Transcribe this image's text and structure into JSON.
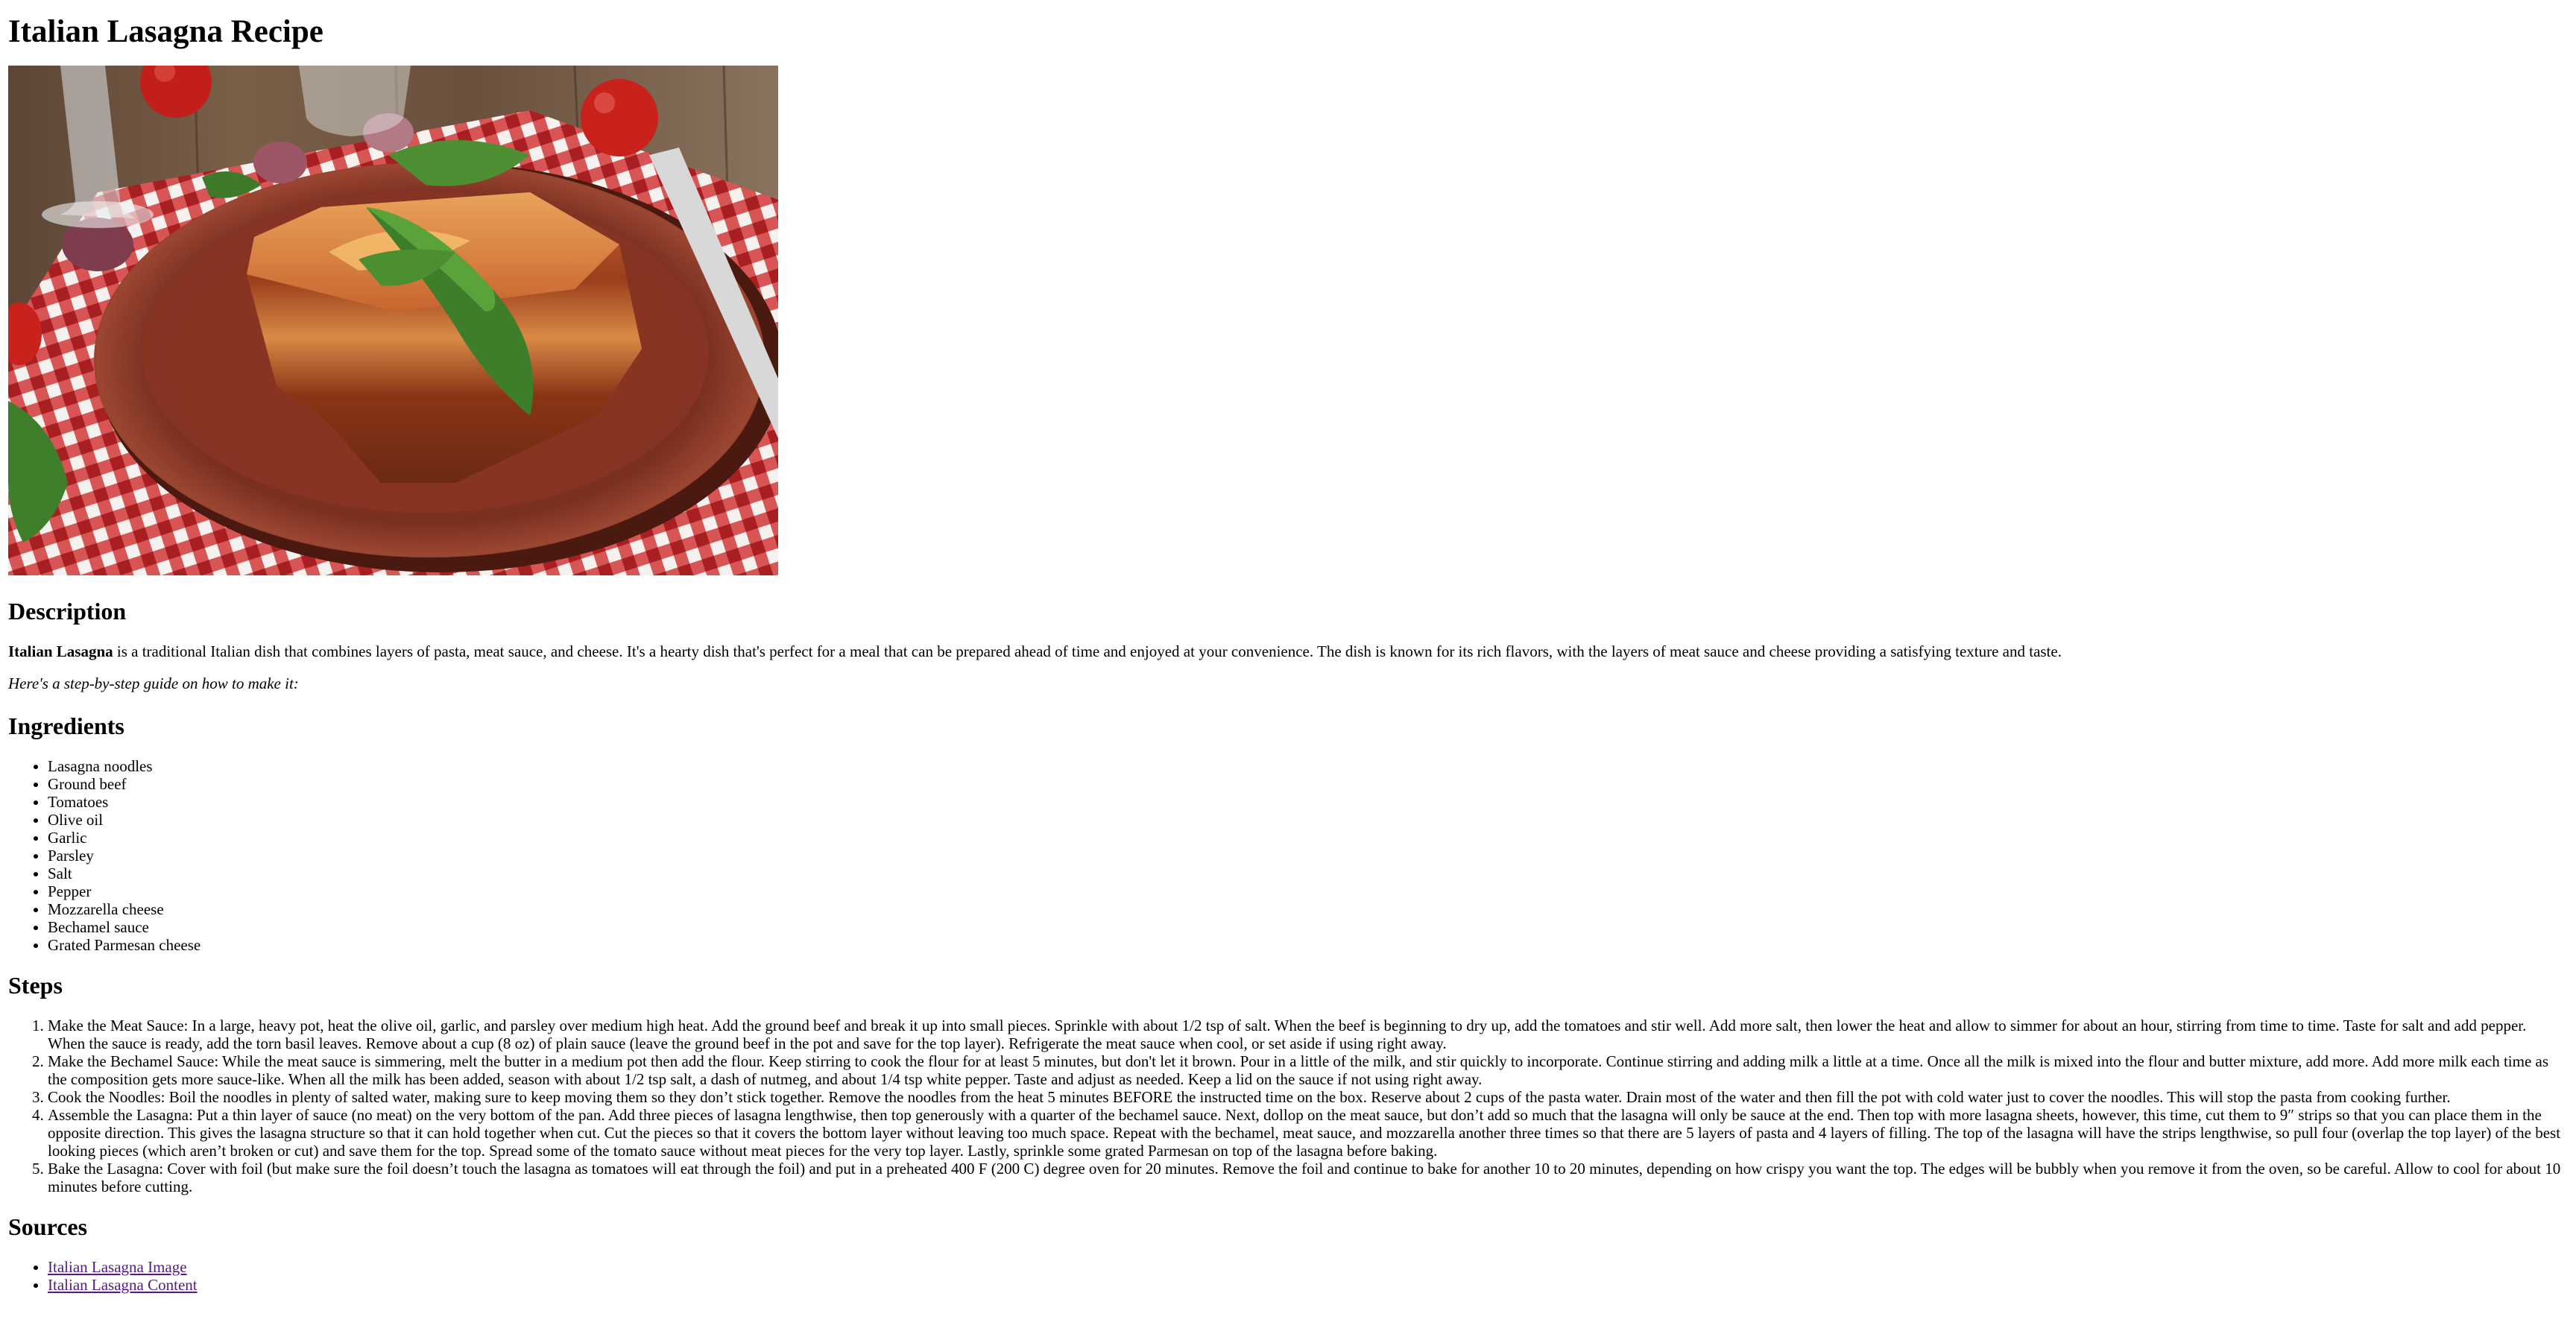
{
  "page": {
    "title": "Italian Lasagna Recipe"
  },
  "hero_image": {
    "alt": "Italian Lasagna"
  },
  "description": {
    "heading": "Description",
    "bold_lead": "Italian Lasagna",
    "text": " is a traditional Italian dish that combines layers of pasta, meat sauce, and cheese. It's a hearty dish that's perfect for a meal that can be prepared ahead of time and enjoyed at your convenience. The dish is known for its rich flavors, with the layers of meat sauce and cheese providing a satisfying texture and taste.",
    "intro": "Here's a step-by-step guide on how to make it:"
  },
  "ingredients": {
    "heading": "Ingredients",
    "items": [
      "Lasagna noodles",
      "Ground beef",
      "Tomatoes",
      "Olive oil",
      "Garlic",
      "Parsley",
      "Salt",
      "Pepper",
      "Mozzarella cheese",
      "Bechamel sauce",
      "Grated Parmesan cheese"
    ]
  },
  "steps": {
    "heading": "Steps",
    "items": [
      "Make the Meat Sauce: In a large, heavy pot, heat the olive oil, garlic, and parsley over medium high heat. Add the ground beef and break it up into small pieces. Sprinkle with about 1/2 tsp of salt. When the beef is beginning to dry up, add the tomatoes and stir well. Add more salt, then lower the heat and allow to simmer for about an hour, stirring from time to time. Taste for salt and add pepper. When the sauce is ready, add the torn basil leaves. Remove about a cup (8 oz) of plain sauce (leave the ground beef in the pot and save for the top layer). Refrigerate the meat sauce when cool, or set aside if using right away.",
      "Make the Bechamel Sauce: While the meat sauce is simmering, melt the butter in a medium pot then add the flour. Keep stirring to cook the flour for at least 5 minutes, but don't let it brown. Pour in a little of the milk, and stir quickly to incorporate. Continue stirring and adding milk a little at a time. Once all the milk is mixed into the flour and butter mixture, add more. Add more milk each time as the composition gets more sauce-like. When all the milk has been added, season with about 1/2 tsp salt, a dash of nutmeg, and about 1/4 tsp white pepper. Taste and adjust as needed. Keep a lid on the sauce if not using right away.",
      "Cook the Noodles: Boil the noodles in plenty of salted water, making sure to keep moving them so they don’t stick together. Remove the noodles from the heat 5 minutes BEFORE the instructed time on the box. Reserve about 2 cups of the pasta water. Drain most of the water and then fill the pot with cold water just to cover the noodles. This will stop the pasta from cooking further.",
      "Assemble the Lasagna: Put a thin layer of sauce (no meat) on the very bottom of the pan. Add three pieces of lasagna lengthwise, then top generously with a quarter of the bechamel sauce. Next, dollop on the meat sauce, but don’t add so much that the lasagna will only be sauce at the end. Then top with more lasagna sheets, however, this time, cut them to 9″ strips so that you can place them in the opposite direction. This gives the lasagna structure so that it can hold together when cut. Cut the pieces so that it covers the bottom layer without leaving too much space. Repeat with the bechamel, meat sauce, and mozzarella another three times so that there are 5 layers of pasta and 4 layers of filling. The top of the lasagna will have the strips lengthwise, so pull four (overlap the top layer) of the best looking pieces (which aren’t broken or cut) and save them for the top. Spread some of the tomato sauce without meat pieces for the very top layer. Lastly, sprinkle some grated Parmesan on top of the lasagna before baking.",
      "Bake the Lasagna: Cover with foil (but make sure the foil doesn’t touch the lasagna as tomatoes will eat through the foil) and put in a preheated 400 F (200 C) degree oven for 20 minutes. Remove the foil and continue to bake for another 10 to 20 minutes, depending on how crispy you want the top. The edges will be bubbly when you remove it from the oven, so be careful. Allow to cool for about 10 minutes before cutting."
    ]
  },
  "sources": {
    "heading": "Sources",
    "links": [
      "Italian Lasagna Image",
      "Italian Lasagna Content"
    ]
  },
  "colors": {
    "link": "#551a8b",
    "text": "#000000",
    "background": "#ffffff"
  }
}
